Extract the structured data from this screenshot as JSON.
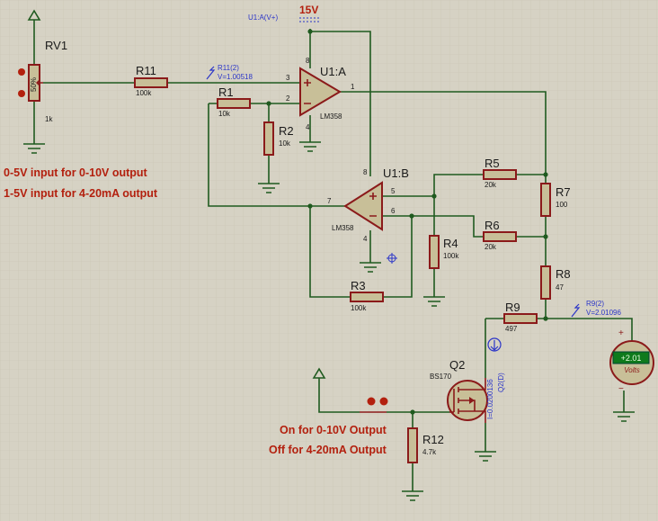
{
  "rail": {
    "label": "15V",
    "probe": "U1:A(V+)"
  },
  "rv1": {
    "ref": "RV1",
    "value": "1k",
    "wiper": "50%"
  },
  "r11": {
    "ref": "R11",
    "value": "100k",
    "probe_name": "R11(2)",
    "probe_value": "V=1.00518"
  },
  "r1": {
    "ref": "R1",
    "value": "10k"
  },
  "r2": {
    "ref": "R2",
    "value": "10k"
  },
  "r3": {
    "ref": "R3",
    "value": "100k"
  },
  "r4": {
    "ref": "R4",
    "value": "100k"
  },
  "r5": {
    "ref": "R5",
    "value": "20k"
  },
  "r6": {
    "ref": "R6",
    "value": "20k"
  },
  "r7": {
    "ref": "R7",
    "value": "100"
  },
  "r8": {
    "ref": "R8",
    "value": "47"
  },
  "r9": {
    "ref": "R9",
    "value": "497",
    "probe_name": "R9(2)",
    "probe_value": "V=2.01096"
  },
  "r12": {
    "ref": "R12",
    "value": "4.7k"
  },
  "u1a": {
    "ref": "U1:A",
    "part": "LM358",
    "pins": [
      "3",
      "2",
      "1",
      "8",
      "4"
    ]
  },
  "u1b": {
    "ref": "U1:B",
    "part": "LM358",
    "pins": [
      "5",
      "6",
      "7",
      "8",
      "4"
    ]
  },
  "q2": {
    "ref": "Q2",
    "part": "BS170",
    "probe_name": "Q2(D)",
    "probe_value": "I=0.0200136"
  },
  "voltmeter": {
    "reading": "+2.01",
    "unit": "Volts",
    "plus": "+",
    "minus": "−"
  },
  "notes": {
    "input_line1": "0-5V input for 0-10V output",
    "input_line2": "1-5V input for 4-20mA output",
    "switch_line1": "On for 0-10V Output",
    "switch_line2": "Off for 4-20mA Output"
  },
  "colors": {
    "background": "#d6d2c4",
    "wire": "#1f5a1f",
    "component": "#8b1a1a",
    "annotation": "#b3200e",
    "probe": "#2b35c8"
  }
}
